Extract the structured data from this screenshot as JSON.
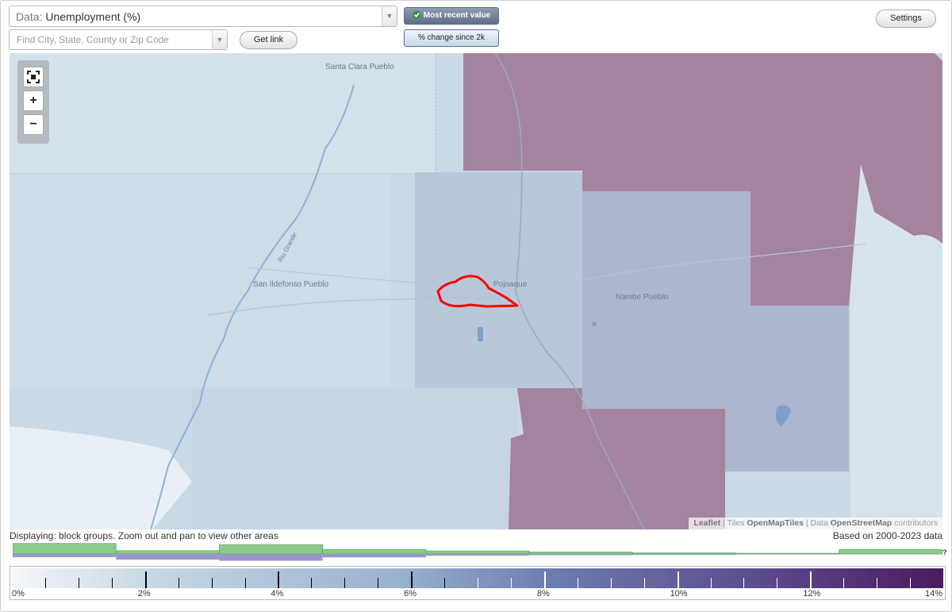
{
  "controls": {
    "data_prefix": "Data:",
    "data_value": "Unemployment (%)",
    "search_placeholder": "Find City, State, County or Zip Code",
    "get_link": "Get link",
    "most_recent": "Most recent value",
    "pct_change": "% change since 2k",
    "settings": "Settings"
  },
  "map": {
    "places": [
      "Santa Clara Pueblo",
      "San Ildefonso Pueblo",
      "Pojoaque",
      "Nambe Pueblo"
    ],
    "road_label": "Rio Grande",
    "zoom": {
      "full": "⤢",
      "in": "+",
      "out": "−"
    },
    "attribution": {
      "leaflet": "Leaflet",
      "sep": "|",
      "tiles": "Tiles",
      "omt": "OpenMapTiles",
      "data": "Data",
      "osm": "OpenStreetMap",
      "contrib": "contributors"
    },
    "colors": {
      "low": "#c9d9e5",
      "mid": "#a9b4cc",
      "high": "#a4839f",
      "highlight": "#ff0000",
      "water": "#7ea0c8"
    }
  },
  "status": {
    "displaying": "Displaying: block groups. Zoom out and pan to view other areas",
    "based_on": "Based on 2000-2023 data"
  },
  "histogram": {
    "question": "?",
    "colors": {
      "green": "#8cc98c",
      "purple": "#9a97cf"
    },
    "green": [
      0.95,
      0.3,
      0.85,
      0.42,
      0.28,
      0.18,
      0.1,
      0.06,
      0.42
    ],
    "purple": [
      0.4,
      0.7,
      0.85,
      0.42,
      0.2,
      0.14,
      0.1,
      0.05,
      0
    ]
  },
  "legend": {
    "ticks": [
      "0%",
      "2%",
      "4%",
      "6%",
      "8%",
      "10%",
      "12%",
      "14%"
    ],
    "min": 0,
    "max": 14
  }
}
